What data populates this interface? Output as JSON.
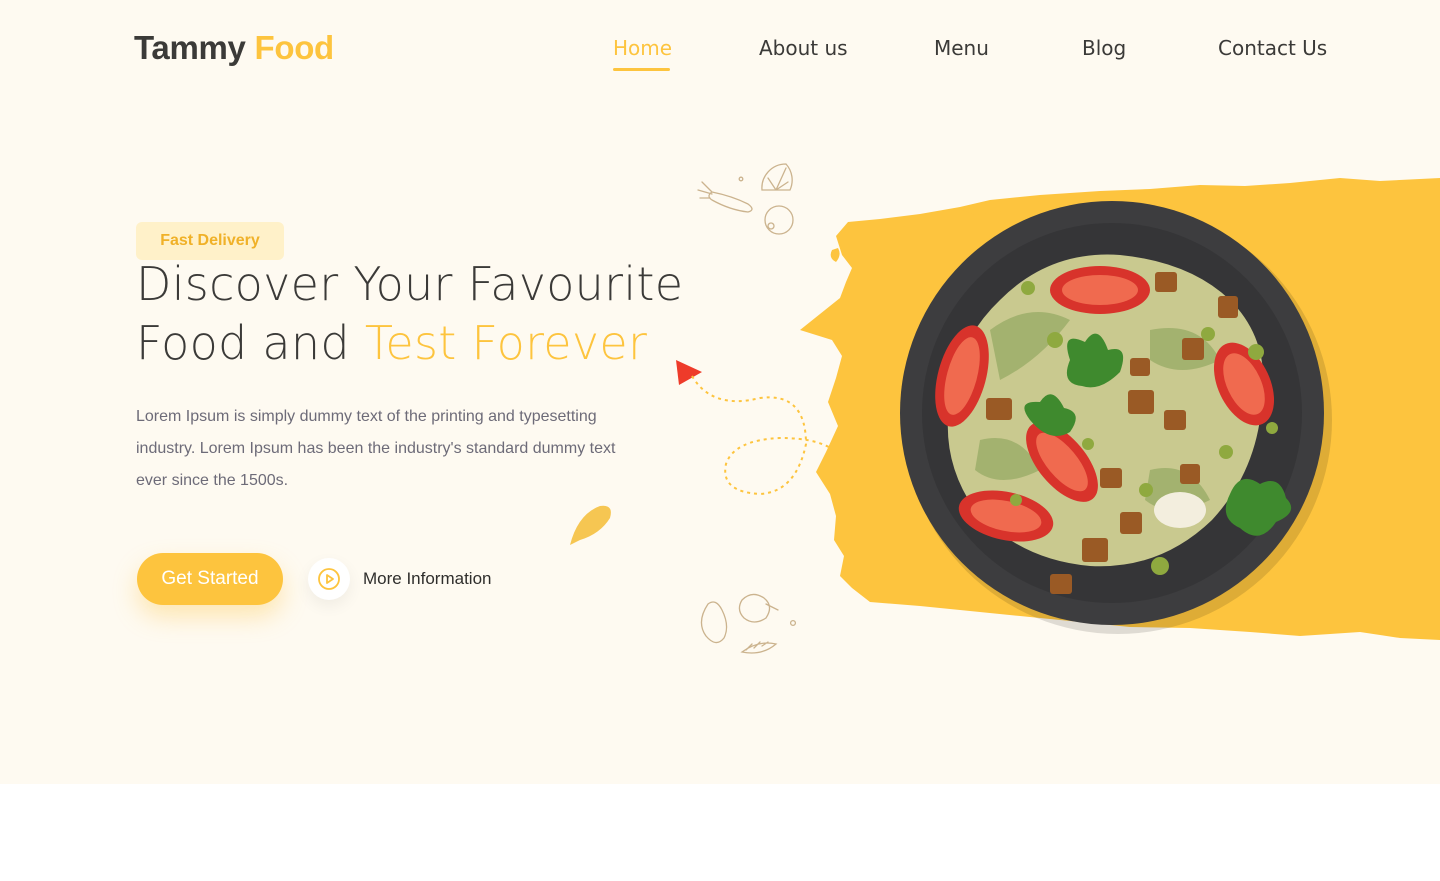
{
  "brand": {
    "name_part1": "Tammy",
    "name_part2": "Food"
  },
  "nav": {
    "items": [
      {
        "label": "Home",
        "active": true
      },
      {
        "label": "About us",
        "active": false
      },
      {
        "label": "Menu",
        "active": false
      },
      {
        "label": "Blog",
        "active": false
      },
      {
        "label": "Contact Us",
        "active": false
      }
    ]
  },
  "hero": {
    "badge": "Fast Delivery",
    "headline_line1": "Discover Your Favourite",
    "headline_line2_plain": "Food and",
    "headline_line2_accent": "Test Forever",
    "description": "Lorem Ipsum is simply dummy text of the printing and typesetting industry. Lorem Ipsum has been the industry's standard dummy text ever since the 1500s.",
    "primary_button": "Get Started",
    "secondary_link": "More Information"
  },
  "icons": {
    "play": "play-circle-icon",
    "doodles": [
      "carrot-icon",
      "lemon-icon",
      "onion-icon",
      "pepper-icon",
      "eggplant-icon",
      "leaf-icon",
      "arrow-icon"
    ]
  },
  "colors": {
    "accent": "#fdc43e",
    "text_dark": "#3b3a38",
    "text_muted": "#6d6b78",
    "hero_bg": "#fefaf1",
    "badge_bg": "#fff1c9",
    "arrow_red": "#ee3b2a"
  }
}
